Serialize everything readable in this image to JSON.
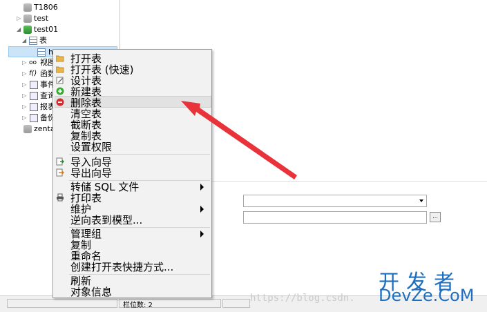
{
  "tree": {
    "items": [
      {
        "label": "T1806"
      },
      {
        "label": "test"
      },
      {
        "label": "test01"
      },
      {
        "label": "表"
      },
      {
        "label": "h"
      },
      {
        "label": "视图"
      },
      {
        "label": "函数"
      },
      {
        "label": "事件"
      },
      {
        "label": "查询"
      },
      {
        "label": "报表"
      },
      {
        "label": "备份"
      },
      {
        "label": "zenta"
      }
    ]
  },
  "context_menu": {
    "items": [
      {
        "label": "打开表",
        "icon": "folder-open-icon"
      },
      {
        "label": "打开表 (快速)",
        "icon": "folder-open-icon"
      },
      {
        "label": "设计表",
        "icon": "pencil-icon"
      },
      {
        "label": "新建表",
        "icon": "add-green-icon"
      },
      {
        "label": "删除表",
        "icon": "delete-red-icon"
      },
      {
        "label": "清空表"
      },
      {
        "label": "截断表"
      },
      {
        "label": "复制表"
      },
      {
        "label": "设置权限"
      },
      {
        "label": "导入向导",
        "icon": "import-icon"
      },
      {
        "label": "导出向导",
        "icon": "export-icon"
      },
      {
        "label": "转储 SQL 文件",
        "submenu": true
      },
      {
        "label": "打印表",
        "icon": "printer-icon"
      },
      {
        "label": "维护",
        "submenu": true
      },
      {
        "label": "逆向表到模型..."
      },
      {
        "label": "管理组",
        "submenu": true
      },
      {
        "label": "复制"
      },
      {
        "label": "重命名"
      },
      {
        "label": "创建打开表快捷方式..."
      },
      {
        "label": "刷新"
      },
      {
        "label": "对象信息"
      }
    ]
  },
  "status": {
    "columns": "栏位数: 2"
  },
  "watermark": {
    "url": "https://blog.csdn.",
    "title": "开发者",
    "brand": "DevZe.CoM"
  },
  "colors": {
    "annotation_arrow": "#e8333a",
    "watermark": "#1f6fc0"
  }
}
